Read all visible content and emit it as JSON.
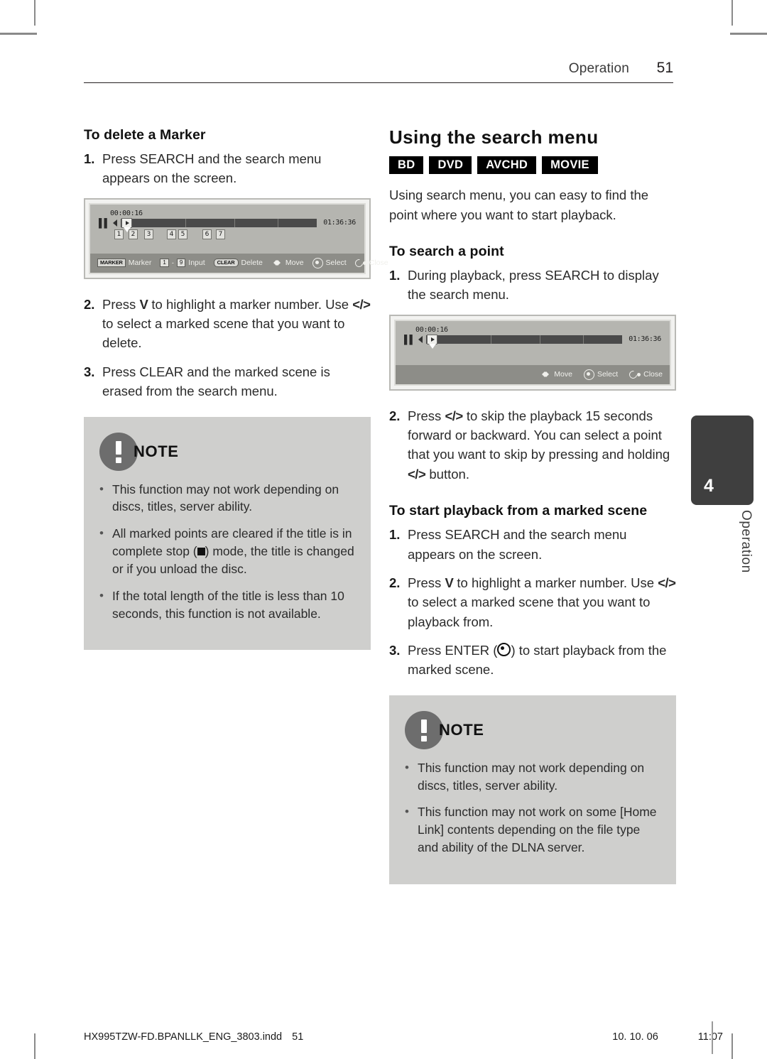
{
  "header": {
    "section": "Operation",
    "page_number": "51"
  },
  "left_column": {
    "heading": "To delete a Marker",
    "steps": [
      {
        "num": "1.",
        "text": "Press SEARCH and the search menu appears on the screen."
      }
    ],
    "figure": {
      "current_time": "00:00:16",
      "total_time": "01:36:36",
      "markers": [
        "1",
        "2",
        "3",
        "4",
        "5",
        "6",
        "7"
      ],
      "hints": [
        {
          "key": "MARKER",
          "label": "Marker"
        },
        {
          "key_from": "1",
          "key_to": "9",
          "label": "Input"
        },
        {
          "key": "CLEAR",
          "label": "Delete"
        },
        {
          "icon": "dpad-icon",
          "label": "Move"
        },
        {
          "icon": "enter-icon",
          "label": "Select"
        },
        {
          "icon": "close-icon",
          "label": "Close"
        }
      ]
    },
    "steps2": [
      {
        "num": "2.",
        "pre": "Press ",
        "k1": "V",
        "mid": " to highlight a marker number. Use ",
        "k2": "</>",
        "post": " to select a marked scene that you want to delete."
      },
      {
        "num": "3.",
        "text": "Press CLEAR and the marked scene is erased from the search menu."
      }
    ],
    "note": {
      "title": "NOTE",
      "items": [
        {
          "text": "This function may not work depending on discs, titles, server ability."
        },
        {
          "pre": "All marked points are cleared if the title is in complete stop (",
          "glyph": "stop-square",
          "post": ") mode, the title is changed or if you unload the disc."
        },
        {
          "text": "If the total length of the title is less than 10 seconds, this function is not available."
        }
      ]
    }
  },
  "right_column": {
    "heading": "Using the search menu",
    "badges": [
      "BD",
      "DVD",
      "AVCHD",
      "MOVIE"
    ],
    "intro": "Using search menu, you can easy to find the point where you want to start playback.",
    "sub1": {
      "heading": "To search a point",
      "step1": {
        "num": "1.",
        "text": "During playback, press SEARCH to display the search menu."
      },
      "figure": {
        "current_time": "00:00:16",
        "total_time": "01:36:36",
        "hints": [
          {
            "icon": "dpad-icon",
            "label": "Move"
          },
          {
            "icon": "enter-icon",
            "label": "Select"
          },
          {
            "icon": "close-icon",
            "label": "Close"
          }
        ]
      },
      "step2": {
        "num": "2.",
        "pre": "Press ",
        "k1": "</>",
        "mid": " to skip the playback 15 seconds forward or backward. You can select a point that you want to skip by pressing and holding ",
        "k2": "</>",
        "post": " button."
      }
    },
    "sub2": {
      "heading": "To start playback from a marked scene",
      "step1": {
        "num": "1.",
        "text": "Press SEARCH and the search menu appears on the screen."
      },
      "step2": {
        "num": "2.",
        "pre": "Press ",
        "k1": "V",
        "mid": " to highlight a marker number. Use ",
        "k2": "</>",
        "post": " to select a marked scene that you want to playback from."
      },
      "step3": {
        "num": "3.",
        "pre": "Press ENTER (",
        "glyph": "enter-circle",
        "post": ") to start playback from the marked scene."
      }
    },
    "note": {
      "title": "NOTE",
      "items": [
        {
          "text": "This function may not work depending on discs, titles, server ability."
        },
        {
          "text": "This function may not work on some [Home Link] contents depending on the file type and ability of the DLNA server."
        }
      ]
    }
  },
  "side_tab": {
    "number": "4",
    "label": "Operation"
  },
  "footer": {
    "filename": "HX995TZW-FD.BPANLLK_ENG_3803.indd",
    "page": "51",
    "date": "10. 10. 06",
    "time": "11:07"
  }
}
